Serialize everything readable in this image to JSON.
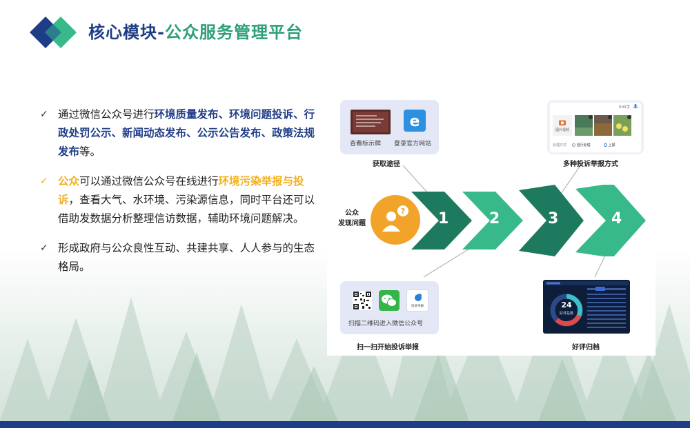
{
  "header": {
    "title_part1": "核心模块-",
    "title_part2": "公众服务管理平台"
  },
  "bullets": {
    "b1": {
      "text1": "通过微信公众号进行",
      "highlight": "环境质量发布、环境问题投诉、行政处罚公示、新闻动态发布、公示公告发布、政策法规发布",
      "text2": "等。"
    },
    "b2": {
      "highlight1": "公众",
      "text1": "可以通过微信公众号在线进行",
      "highlight2": "环境污染举报与投诉",
      "text2": "，查看大气、水环境、污染源信息，同时平台还可以借助发数据分析整理信访数据，辅助环境问题解决。"
    },
    "b3": {
      "text": "形成政府与公众良性互动、共建共享、人人参与的生态格局。"
    },
    "check_glyph": "✓"
  },
  "diagram": {
    "access": {
      "title": "获取途径",
      "item1": "查看标示牌",
      "item2": "登录官方网站"
    },
    "methods": {
      "title": "多种投诉举报方式",
      "char_count": "500字",
      "image_label": "图片视频",
      "option_label": "处理方式",
      "option1": "自行处理",
      "option2": "上报"
    },
    "public": {
      "line1": "公众",
      "line2": "发现问题"
    },
    "steps": [
      "1",
      "2",
      "3",
      "4"
    ],
    "scan": {
      "title": "扫一扫开始投诉举报",
      "caption": "扫描二维码进入微信公众号",
      "mini_label": "投诉举报"
    },
    "archive": {
      "title": "好评归档",
      "number": "24",
      "number_label": "好评总数"
    }
  },
  "colors": {
    "navy": "#1f3d86",
    "green": "#2e9f7c",
    "gold": "#f2b01e",
    "arrow_dark": "#1d7a5e",
    "arrow_light": "#37b98a",
    "orange": "#f2a32a"
  }
}
